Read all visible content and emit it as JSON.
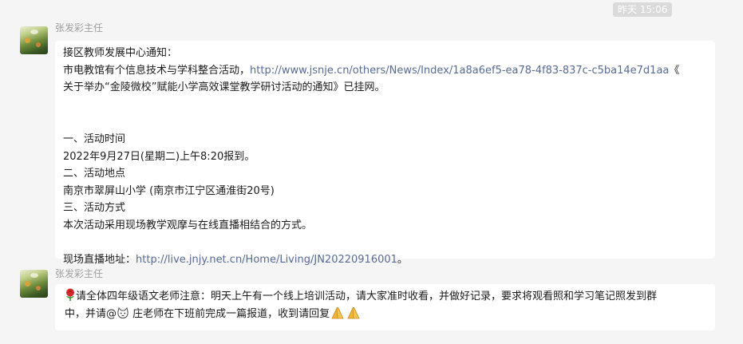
{
  "timestamp": "昨天 15:06",
  "messages": [
    {
      "sender": "张发彩主任",
      "lines": {
        "l1": "接区教师发展中心通知：",
        "l2_pre": "市电教馆有个信息技术与学科整合活动，",
        "l2_link": "http://www.jsnje.cn/others/News/Index/1a8a6ef5-ea78-4f83-837c-c5ba14e7d1aa",
        "l2_post": "《",
        "l3": "关于举办“金陵微校”赋能小学高效课堂教学研讨活动的通知》已挂网。",
        "l4": "一、活动时间",
        "l5": "2022年9月27日(星期二)上午8:20报到。",
        "l6": "二、活动地点",
        "l7": "南京市翠屏山小学 (南京市江宁区通淮街20号)",
        "l8": "三、活动方式",
        "l9": "本次活动采用现场教学观摩与在线直播相结合的方式。",
        "l10_pre": "现场直播地址：",
        "l10_link": "http://live.jnjy.net.cn/Home/Living/JN20220916001",
        "l10_post": "。"
      }
    },
    {
      "sender": "张发彩主任",
      "lines": {
        "l1": "请全体四年级语文老师注意：明天上午有一个线上培训活动，请大家准时收看，并做好记录，要求将观看照和学习笔记照发到群",
        "l2_pre": "中，并请@",
        "l2_mid": " 庄老师在下班前完成一篇报道，收到请回复"
      }
    }
  ],
  "icons": [
    "rose-icon",
    "cat-face-icon",
    "folded-hands-icon"
  ],
  "colors": {
    "link": "#576b95",
    "bubble": "#ffffff",
    "background": "#f5f5f5"
  }
}
